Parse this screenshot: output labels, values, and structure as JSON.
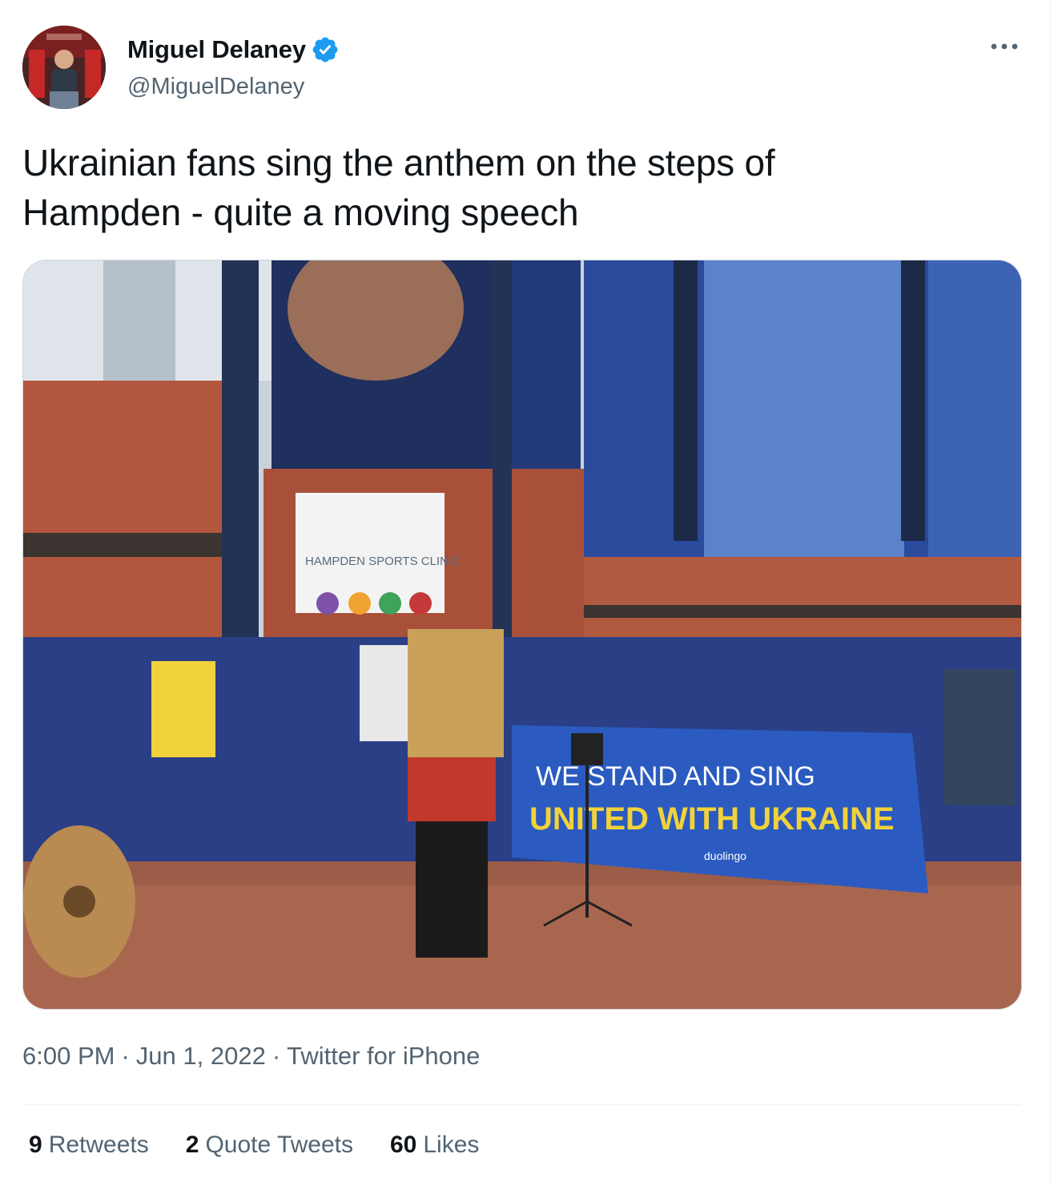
{
  "author": {
    "display_name": "Miguel Delaney",
    "handle": "@MiguelDelaney",
    "verified": true
  },
  "tweet": {
    "text_line1": "Ukrainian fans sing the anthem on the steps of",
    "text_line2": "Hampden - quite a moving speech"
  },
  "photo": {
    "clinic_sign": "HAMPDEN SPORTS CLINIC",
    "banner_line1": "WE STAND AND SING",
    "banner_line2": "UNITED WITH UKRAINE",
    "banner_sponsor": "duolingo"
  },
  "meta": {
    "time": "6:00 PM",
    "date": "Jun 1, 2022",
    "source": "Twitter for iPhone",
    "separator": "·"
  },
  "stats": {
    "retweets_count": "9",
    "retweets_label": "Retweets",
    "quotes_count": "2",
    "quotes_label": "Quote Tweets",
    "likes_count": "60",
    "likes_label": "Likes"
  },
  "colors": {
    "text_primary": "#0f1419",
    "text_secondary": "#536471",
    "verified_blue": "#1d9bf0",
    "divider": "#eff3f4"
  }
}
